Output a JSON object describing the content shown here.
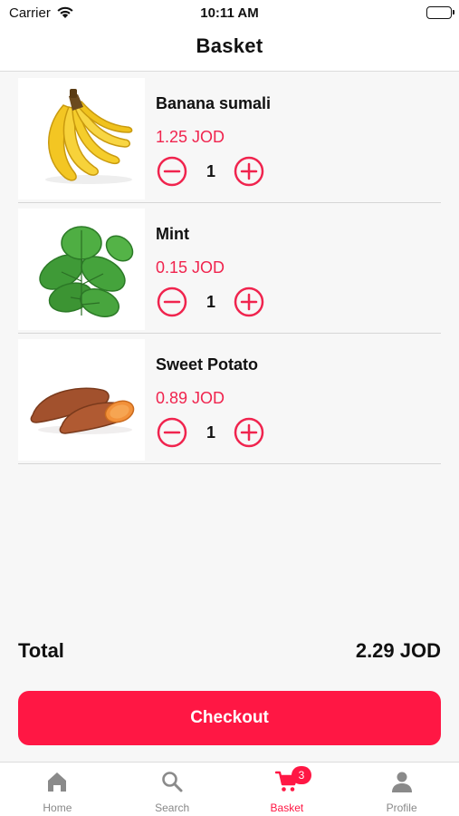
{
  "status_bar": {
    "carrier": "Carrier",
    "time": "10:11 AM"
  },
  "nav": {
    "title": "Basket"
  },
  "items": [
    {
      "name": "Banana sumali",
      "price": "1.25 JOD",
      "quantity": "1",
      "image_icon": "banana-image"
    },
    {
      "name": "Mint",
      "price": "0.15 JOD",
      "quantity": "1",
      "image_icon": "mint-image"
    },
    {
      "name": "Sweet Potato",
      "price": "0.89 JOD",
      "quantity": "1",
      "image_icon": "sweet-potato-image"
    }
  ],
  "total": {
    "label": "Total",
    "value": "2.29 JOD"
  },
  "checkout_label": "Checkout",
  "tabs": [
    {
      "label": "Home",
      "icon": "home-icon"
    },
    {
      "label": "Search",
      "icon": "search-icon"
    },
    {
      "label": "Basket",
      "icon": "cart-icon",
      "active": true,
      "badge": "3"
    },
    {
      "label": "Profile",
      "icon": "profile-icon"
    }
  ],
  "colors": {
    "accent": "#ff1744",
    "price": "#f0244e",
    "inactive_tab": "#888888"
  }
}
